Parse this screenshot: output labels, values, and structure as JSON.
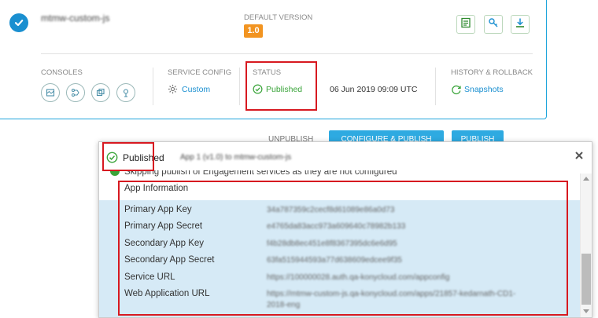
{
  "app_card": {
    "app_name": "mtmw-custom-js",
    "default_version_label": "DEFAULT VERSION",
    "version_badge": "1.0",
    "consoles_label": "CONSOLES",
    "service_config_label": "SERVICE CONFIG",
    "service_config_value": "Custom",
    "status_label": "STATUS",
    "status_value": "Published",
    "status_date": "06 Jun 2019 09:09 UTC",
    "history_label": "HISTORY & ROLLBACK",
    "snapshots_label": "Snapshots"
  },
  "actions": {
    "unpublish": "UNPUBLISH",
    "configure_publish": "CONFIGURE & PUBLISH",
    "publish": "PUBLISH"
  },
  "modal": {
    "published_label": "Published",
    "app_name_blurred": "App 1 (v1.0) to mtmw-custom-js",
    "skipping_text": "Skipping publish of Engagement services as they are not configured",
    "app_information_label": "App Information",
    "rows": [
      {
        "key": "Primary App Key",
        "value": "34a787359c2cecf8d61089e86a0d73"
      },
      {
        "key": "Primary App Secret",
        "value": "e4765da83acc973a609640c78982b133"
      },
      {
        "key": "Secondary App Key",
        "value": "f4b28db8ec451e8f8367395dc6e6d95"
      },
      {
        "key": "Secondary App Secret",
        "value": "63fa515944593a77d638609edcee9f35"
      },
      {
        "key": "Service URL",
        "value": "https://100000028.auth.qa-konycloud.com/appconfig"
      },
      {
        "key": "Web Application URL",
        "value": "https://mtmw-custom-js.qa-konycloud.com/apps/21857-kedarnath-CD1-",
        "value2": "2018-eng"
      }
    ]
  },
  "colors": {
    "accent_blue": "#1a8fd0",
    "status_green": "#3aa43a",
    "badge_orange": "#f29421",
    "highlight_red": "#d71920",
    "panel_blue": "#d6eaf6"
  },
  "icons": [
    "check-icon",
    "report-icon",
    "key-icon",
    "download-icon",
    "gear-icon",
    "sync-icon",
    "close-icon"
  ]
}
